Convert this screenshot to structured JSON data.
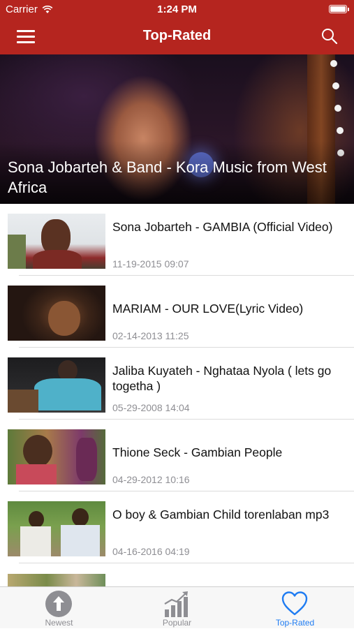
{
  "status_bar": {
    "carrier": "Carrier",
    "time": "1:24 PM"
  },
  "header": {
    "title": "Top-Rated",
    "menu_icon": "hamburger-menu-icon",
    "search_icon": "search-icon"
  },
  "colors": {
    "header_bg": "#b5251f",
    "active_tab": "#1f7cf2",
    "inactive_tab": "#8e8e93"
  },
  "featured": {
    "title": "Sona Jobarteh & Band - Kora Music from West Africa"
  },
  "videos": [
    {
      "title": "Sona Jobarteh - GAMBIA (Official Video)",
      "date": "11-19-2015 09:07"
    },
    {
      "title": "MARIAM - OUR LOVE(Lyric Video)",
      "date": "02-14-2013 11:25"
    },
    {
      "title": "Jaliba Kuyateh - Nghataa Nyola ( lets go togetha )",
      "date": "05-29-2008 14:04"
    },
    {
      "title": "Thione Seck - Gambian People",
      "date": "04-29-2012 10:16"
    },
    {
      "title": "O boy & Gambian Child torenlaban mp3",
      "date": "04-16-2016 04:19"
    }
  ],
  "tabs": [
    {
      "label": "Newest",
      "icon": "up-arrow-circle-icon",
      "active": false
    },
    {
      "label": "Popular",
      "icon": "bar-chart-trend-icon",
      "active": false
    },
    {
      "label": "Top-Rated",
      "icon": "heart-icon",
      "active": true
    }
  ]
}
